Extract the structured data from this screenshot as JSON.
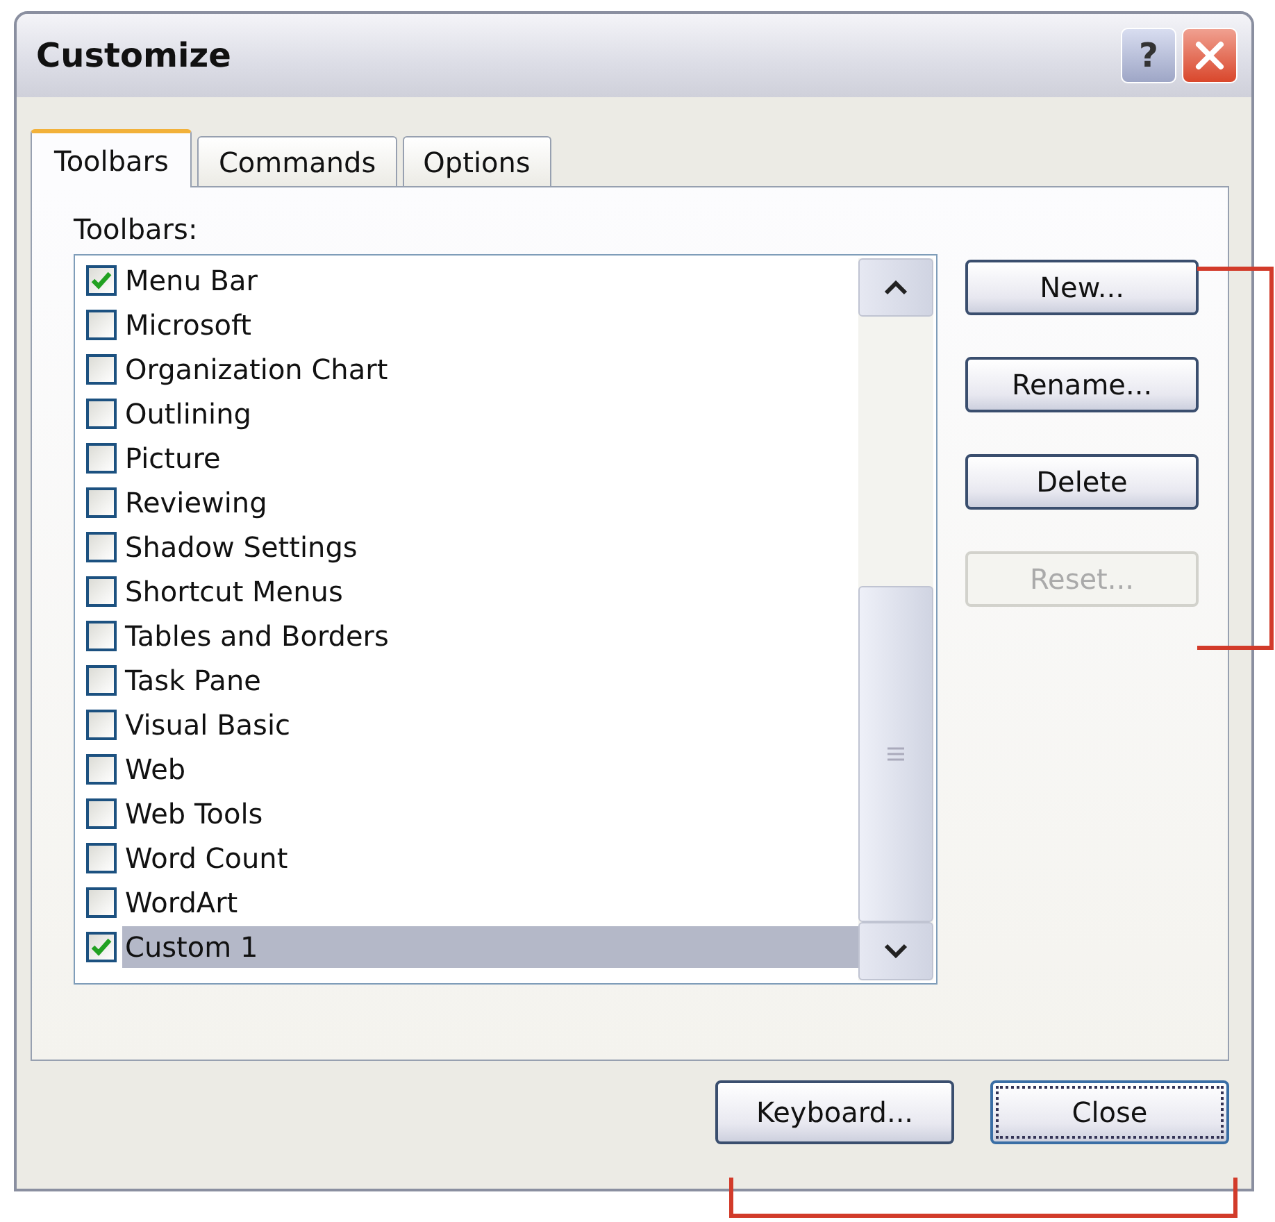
{
  "window": {
    "title": "Customize",
    "help_button": "?"
  },
  "tabs": [
    {
      "label": "Toolbars",
      "selected": true
    },
    {
      "label": "Commands",
      "selected": false
    },
    {
      "label": "Options",
      "selected": false
    }
  ],
  "list_label": {
    "text": "Toolbars:"
  },
  "toolbars": [
    {
      "label": "Menu Bar",
      "checked": true,
      "selected": false
    },
    {
      "label": "Microsoft",
      "checked": false,
      "selected": false
    },
    {
      "label": "Organization Chart",
      "checked": false,
      "selected": false
    },
    {
      "label": "Outlining",
      "checked": false,
      "selected": false
    },
    {
      "label": "Picture",
      "checked": false,
      "selected": false
    },
    {
      "label": "Reviewing",
      "checked": false,
      "selected": false
    },
    {
      "label": "Shadow Settings",
      "checked": false,
      "selected": false
    },
    {
      "label": "Shortcut Menus",
      "checked": false,
      "selected": false
    },
    {
      "label": "Tables and Borders",
      "checked": false,
      "selected": false
    },
    {
      "label": "Task Pane",
      "checked": false,
      "selected": false
    },
    {
      "label": "Visual Basic",
      "checked": false,
      "selected": false
    },
    {
      "label": "Web",
      "checked": false,
      "selected": false
    },
    {
      "label": "Web Tools",
      "checked": false,
      "selected": false
    },
    {
      "label": "Word Count",
      "checked": false,
      "selected": false
    },
    {
      "label": "WordArt",
      "checked": false,
      "selected": false
    },
    {
      "label": "Custom 1",
      "checked": true,
      "selected": true
    }
  ],
  "side_buttons": [
    {
      "label": "New...",
      "disabled": false
    },
    {
      "label": "Rename...",
      "disabled": false
    },
    {
      "label": "Delete",
      "disabled": false
    },
    {
      "label": "Reset...",
      "disabled": true
    }
  ],
  "footer_buttons": [
    {
      "label": "Keyboard...",
      "focused": false
    },
    {
      "label": "Close",
      "focused": true
    }
  ],
  "callout_brackets": {
    "right": true,
    "bottom": true
  }
}
